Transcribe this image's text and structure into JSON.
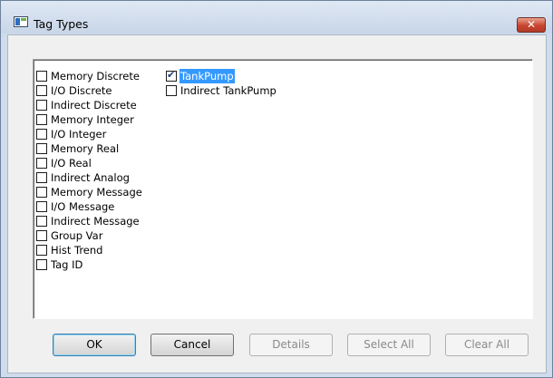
{
  "window": {
    "title": "Tag Types",
    "close_label": "✕"
  },
  "tag_types": {
    "left_column": [
      {
        "label": "Memory Discrete",
        "checked": false
      },
      {
        "label": "I/O Discrete",
        "checked": false
      },
      {
        "label": "Indirect Discrete",
        "checked": false
      },
      {
        "label": "Memory Integer",
        "checked": false
      },
      {
        "label": "I/O Integer",
        "checked": false
      },
      {
        "label": "Memory Real",
        "checked": false
      },
      {
        "label": "I/O Real",
        "checked": false
      },
      {
        "label": "Indirect Analog",
        "checked": false
      },
      {
        "label": "Memory Message",
        "checked": false
      },
      {
        "label": "I/O Message",
        "checked": false
      },
      {
        "label": "Indirect Message",
        "checked": false
      },
      {
        "label": "Group Var",
        "checked": false
      },
      {
        "label": "Hist Trend",
        "checked": false
      },
      {
        "label": "Tag ID",
        "checked": false
      }
    ],
    "right_column": [
      {
        "label": "TankPump",
        "checked": true,
        "selected": true
      },
      {
        "label": "Indirect TankPump",
        "checked": false
      }
    ]
  },
  "buttons": {
    "ok": "OK",
    "cancel": "Cancel",
    "details": "Details",
    "select_all": "Select All",
    "clear_all": "Clear All"
  }
}
